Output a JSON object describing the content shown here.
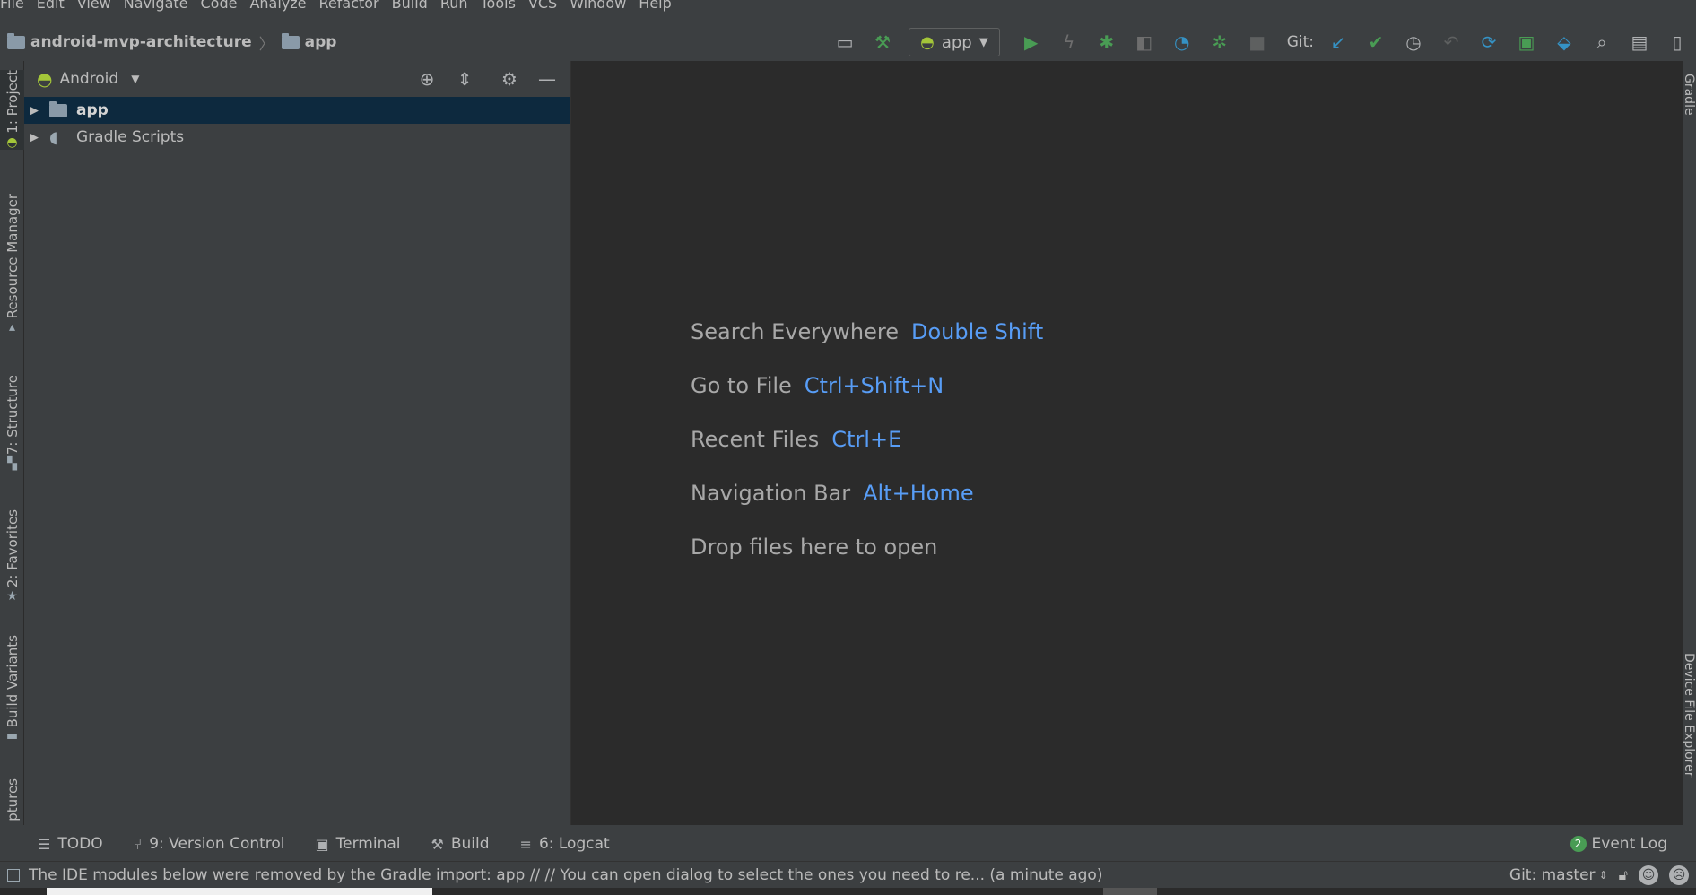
{
  "menu": [
    "File",
    "Edit",
    "View",
    "Navigate",
    "Code",
    "Analyze",
    "Refactor",
    "Build",
    "Run",
    "Tools",
    "VCS",
    "Window",
    "Help"
  ],
  "breadcrumb": {
    "project": "android-mvp-architecture",
    "module": "app"
  },
  "toolbar": {
    "run_config": "app",
    "git_label": "Git:"
  },
  "left_tabs": [
    "1: Project",
    "Resource Manager",
    "7: Structure",
    "2: Favorites",
    "Build Variants",
    "ptures"
  ],
  "right_tabs": [
    "Gradle",
    "Device File Explorer"
  ],
  "project_panel": {
    "view_mode": "Android",
    "tree": [
      {
        "label": "app",
        "selected": true
      },
      {
        "label": "Gradle Scripts",
        "selected": false
      }
    ]
  },
  "welcome": [
    {
      "action": "Search Everywhere",
      "shortcut": "Double Shift"
    },
    {
      "action": "Go to File",
      "shortcut": "Ctrl+Shift+N"
    },
    {
      "action": "Recent Files",
      "shortcut": "Ctrl+E"
    },
    {
      "action": "Navigation Bar",
      "shortcut": "Alt+Home"
    },
    {
      "action": "Drop files here to open",
      "shortcut": ""
    }
  ],
  "bottom_tabs": [
    {
      "label": "TODO",
      "icon": "list-icon"
    },
    {
      "label": "9: Version Control",
      "icon": "branch-icon"
    },
    {
      "label": "Terminal",
      "icon": "terminal-icon"
    },
    {
      "label": "Build",
      "icon": "hammer-icon"
    },
    {
      "label": "6: Logcat",
      "icon": "logcat-icon"
    }
  ],
  "event_log": {
    "label": "Event Log",
    "count": "2"
  },
  "status": {
    "message": "The IDE modules below were removed by the Gradle import: app // // You can open dialog to select the ones you need to re... (a minute ago)",
    "git_branch": "Git: master"
  },
  "colors": {
    "accent_link": "#589df6",
    "selection": "#0d293e",
    "android_green": "#a4c639",
    "run_green": "#499c54"
  }
}
